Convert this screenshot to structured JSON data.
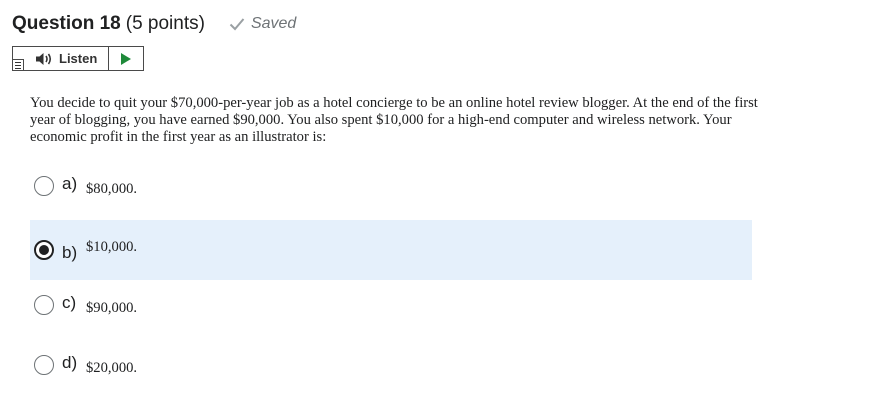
{
  "header": {
    "title": "Question 18",
    "points": "(5 points)",
    "saved_label": "Saved",
    "saved_icon": "check-icon"
  },
  "listen": {
    "label": "Listen",
    "speaker_icon": "speaker-icon",
    "play_icon": "play-icon",
    "menu_icon": "menu-icon",
    "play_color": "#1f8a3a"
  },
  "question": {
    "text": "You decide to quit your $70,000-per-year job as a hotel concierge to be an online hotel review blogger. At the end of the first year of blogging, you have earned $90,000. You also spent $10,000 for a high-end computer and wireless network. Your economic profit in the first year as an illustrator is:"
  },
  "options": [
    {
      "letter": "a)",
      "text": "$80,000.",
      "selected": false
    },
    {
      "letter": "b)",
      "text": "$10,000.",
      "selected": true
    },
    {
      "letter": "c)",
      "text": "$90,000.",
      "selected": false
    },
    {
      "letter": "d)",
      "text": "$20,000.",
      "selected": false
    }
  ],
  "colors": {
    "selected_background": "#e5f0fb",
    "saved_text": "#6e7376"
  }
}
